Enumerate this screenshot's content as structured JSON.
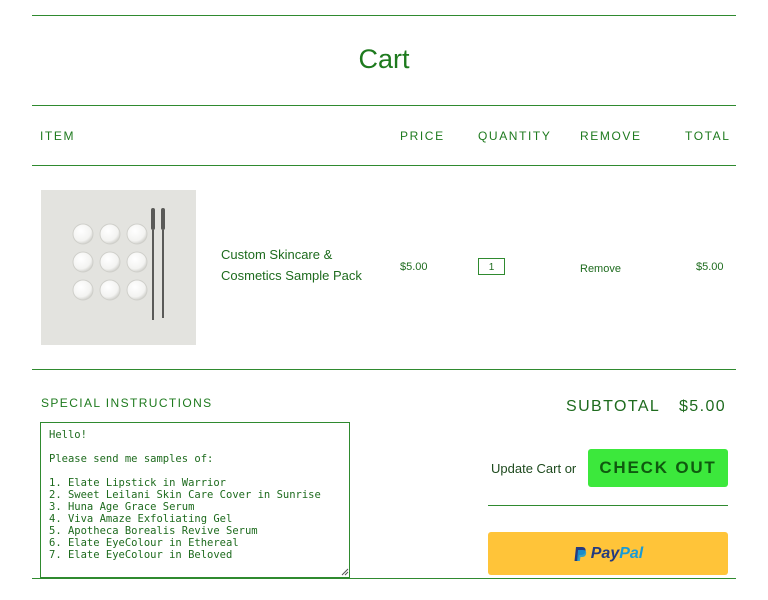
{
  "page": {
    "title": "Cart"
  },
  "table": {
    "headers": {
      "item": "ITEM",
      "price": "PRICE",
      "quantity": "QUANTITY",
      "remove": "REMOVE",
      "total": "TOTAL"
    }
  },
  "item": {
    "name": "Custom Skincare & Cosmetics Sample Pack",
    "price": "$5.00",
    "quantity": "1",
    "remove": "Remove",
    "total": "$5.00"
  },
  "special_instructions": {
    "label": "SPECIAL INSTRUCTIONS",
    "value": "Hello!\n\nPlease send me samples of:\n\n1. Elate Lipstick in Warrior\n2. Sweet Leilani Skin Care Cover in Sunrise\n3. Huna Age Grace Serum\n4. Viva Amaze Exfoliating Gel\n5. Apotheca Borealis Revive Serum\n6. Elate EyeColour in Ethereal\n7. Elate EyeColour in Beloved"
  },
  "summary": {
    "subtotal_label": "SUBTOTAL",
    "subtotal_value": "$5.00",
    "update_cart": "Update Cart or",
    "checkout": "CHECK OUT"
  },
  "paypal": {
    "pay": "Pay",
    "pal": "Pal"
  },
  "colors": {
    "accent": "#1e7a1e",
    "checkout_bg": "#3ce83c",
    "paypal_bg": "#ffc439"
  }
}
